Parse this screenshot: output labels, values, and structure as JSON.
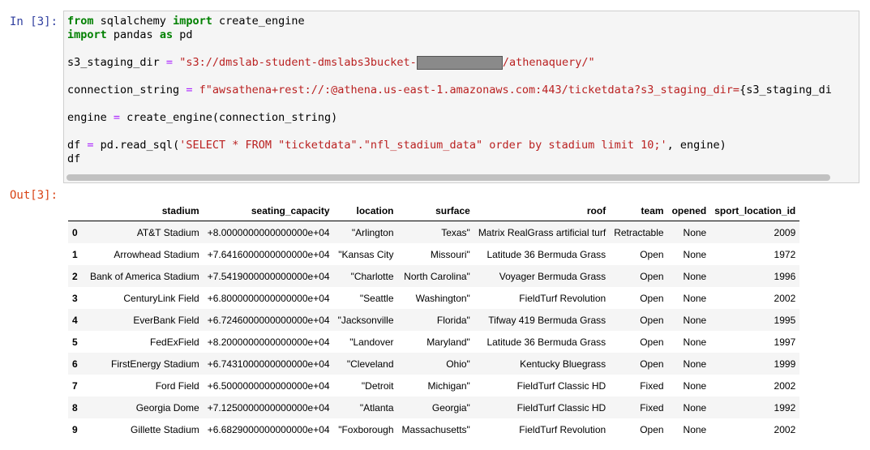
{
  "cell": {
    "in_prompt": "In [3]:",
    "out_prompt": "Out[3]:",
    "code": {
      "line1": {
        "kw1": "from",
        "mod": " sqlalchemy ",
        "kw2": "import",
        "rest": " create_engine"
      },
      "line2": {
        "kw1": "import",
        "mod": " pandas ",
        "kw2": "as",
        "rest": " pd"
      },
      "line3": {
        "var": "s3_staging_dir ",
        "op": "=",
        "sp": " ",
        "str1": "\"s3://dmslab-student-dmslabs3bucket-",
        "str2": "/athenaquery/\""
      },
      "line4": {
        "var": "connection_string ",
        "op": "=",
        "sp": " ",
        "str": "f\"awsathena+rest://:@athena.us-east-1.amazonaws.com:443/ticketdata?s3_staging_dir=",
        "tail": "{s3_staging_di"
      },
      "line5": {
        "var": "engine ",
        "op": "=",
        "rest": " create_engine(connection_string)"
      },
      "line6": {
        "var": "df ",
        "op": "=",
        "mid": " pd.read_sql(",
        "str": "'SELECT * FROM \"ticketdata\".\"nfl_stadium_data\" order by stadium limit 10;'",
        "rest": ", engine)"
      },
      "line7": "df"
    },
    "output_table": {
      "columns": [
        "stadium",
        "seating_capacity",
        "location",
        "surface",
        "roof",
        "team",
        "opened",
        "sport_location_id"
      ],
      "rows": [
        {
          "index": "0",
          "stadium": "AT&T Stadium",
          "seating_capacity": "+8.0000000000000000e+04",
          "location": "\"Arlington",
          "surface": "Texas\"",
          "roof": "Matrix RealGrass artificial turf",
          "team": "Retractable",
          "opened": "None",
          "sport_location_id": "2009"
        },
        {
          "index": "1",
          "stadium": "Arrowhead Stadium",
          "seating_capacity": "+7.6416000000000000e+04",
          "location": "\"Kansas City",
          "surface": "Missouri\"",
          "roof": "Latitude 36 Bermuda Grass",
          "team": "Open",
          "opened": "None",
          "sport_location_id": "1972"
        },
        {
          "index": "2",
          "stadium": "Bank of America Stadium",
          "seating_capacity": "+7.5419000000000000e+04",
          "location": "\"Charlotte",
          "surface": "North Carolina\"",
          "roof": "Voyager Bermuda Grass",
          "team": "Open",
          "opened": "None",
          "sport_location_id": "1996"
        },
        {
          "index": "3",
          "stadium": "CenturyLink Field",
          "seating_capacity": "+6.8000000000000000e+04",
          "location": "\"Seattle",
          "surface": "Washington\"",
          "roof": "FieldTurf Revolution",
          "team": "Open",
          "opened": "None",
          "sport_location_id": "2002"
        },
        {
          "index": "4",
          "stadium": "EverBank Field",
          "seating_capacity": "+6.7246000000000000e+04",
          "location": "\"Jacksonville",
          "surface": "Florida\"",
          "roof": "Tifway 419 Bermuda Grass",
          "team": "Open",
          "opened": "None",
          "sport_location_id": "1995"
        },
        {
          "index": "5",
          "stadium": "FedExField",
          "seating_capacity": "+8.2000000000000000e+04",
          "location": "\"Landover",
          "surface": "Maryland\"",
          "roof": "Latitude 36 Bermuda Grass",
          "team": "Open",
          "opened": "None",
          "sport_location_id": "1997"
        },
        {
          "index": "6",
          "stadium": "FirstEnergy Stadium",
          "seating_capacity": "+6.7431000000000000e+04",
          "location": "\"Cleveland",
          "surface": "Ohio\"",
          "roof": "Kentucky Bluegrass",
          "team": "Open",
          "opened": "None",
          "sport_location_id": "1999"
        },
        {
          "index": "7",
          "stadium": "Ford Field",
          "seating_capacity": "+6.5000000000000000e+04",
          "location": "\"Detroit",
          "surface": "Michigan\"",
          "roof": "FieldTurf Classic HD",
          "team": "Fixed",
          "opened": "None",
          "sport_location_id": "2002"
        },
        {
          "index": "8",
          "stadium": "Georgia Dome",
          "seating_capacity": "+7.1250000000000000e+04",
          "location": "\"Atlanta",
          "surface": "Georgia\"",
          "roof": "FieldTurf Classic HD",
          "team": "Fixed",
          "opened": "None",
          "sport_location_id": "1992"
        },
        {
          "index": "9",
          "stadium": "Gillette Stadium",
          "seating_capacity": "+6.6829000000000000e+04",
          "location": "\"Foxborough",
          "surface": "Massachusetts\"",
          "roof": "FieldTurf Revolution",
          "team": "Open",
          "opened": "None",
          "sport_location_id": "2002"
        }
      ]
    }
  },
  "colors": {
    "keyword": "#008000",
    "operator": "#aa22ff",
    "string": "#ba2121",
    "in_prompt": "#303f9f",
    "out_prompt": "#d84315"
  }
}
